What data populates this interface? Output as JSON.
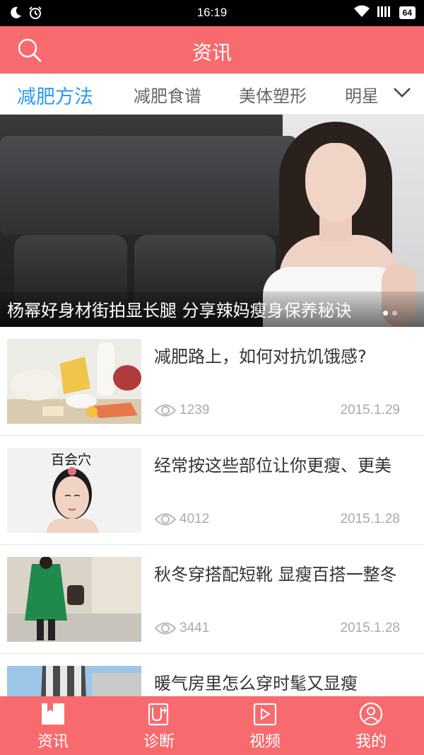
{
  "status_bar": {
    "time": "16:19",
    "battery": "64",
    "icons": [
      "moon-icon",
      "alarm-icon",
      "wifi-icon",
      "signal-icon",
      "battery-icon"
    ]
  },
  "header": {
    "title": "资讯",
    "search_icon": "search-icon"
  },
  "tabs": [
    {
      "label": "减肥方法",
      "active": true
    },
    {
      "label": "减肥食谱",
      "active": false
    },
    {
      "label": "美体塑形",
      "active": false
    },
    {
      "label": "明星",
      "active": false
    }
  ],
  "tabs_more_icon": "chevron-down-icon",
  "banner": {
    "caption": "杨幂好身材街拍显长腿 分享辣妈瘦身保养秘诀",
    "slides": 2,
    "active_slide": 1
  },
  "news": [
    {
      "title": "减肥路上，如何对抗饥饿感?",
      "views": "1239",
      "date": "2015.1.29",
      "thumb": "food"
    },
    {
      "title": "经常按这些部位让你更瘦、更美",
      "views": "4012",
      "date": "2015.1.28",
      "thumb": "acupoint",
      "thumb_text": "百会穴"
    },
    {
      "title": "秋冬穿搭配短靴 显瘦百搭一整冬",
      "views": "3441",
      "date": "2015.1.28",
      "thumb": "fashion"
    },
    {
      "title": "暖气房里怎么穿时髦又显瘦",
      "views": "",
      "date": "",
      "thumb": "coat"
    }
  ],
  "bottom_nav": [
    {
      "label": "资讯",
      "icon": "news-icon"
    },
    {
      "label": "诊断",
      "icon": "diagnosis-icon"
    },
    {
      "label": "视频",
      "icon": "video-icon"
    },
    {
      "label": "我的",
      "icon": "profile-icon"
    }
  ],
  "colors": {
    "brand": "#f76a6e",
    "tab_active": "#2b9af3",
    "text": "#333333",
    "meta": "#aaaaaa"
  }
}
